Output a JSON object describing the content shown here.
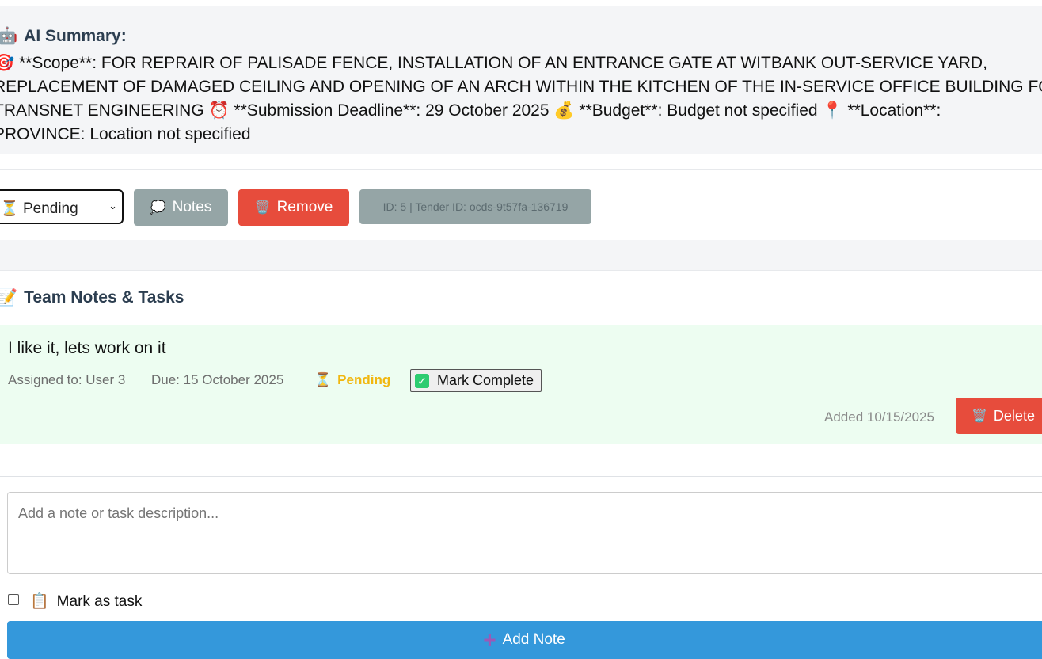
{
  "ai_summary": {
    "icon": "robot-icon",
    "title": "AI Summary:",
    "lines": [
      "🎯 **Scope**: FOR REPRAIR OF PALISADE FENCE, INSTALLATION OF AN ENTRANCE GATE AT WITBANK OUT-SERVICE YARD,",
      "REPLACEMENT OF DAMAGED CEILING AND OPENING OF AN ARCH WITHIN THE KITCHEN OF THE IN-SERVICE OFFICE BUILDING FOR",
      "TRANSNET ENGINEERING ⏰ **Submission Deadline**: 29 October 2025 💰 **Budget**: Budget not specified 📍 **Location**:",
      "PROVINCE: Location not specified"
    ]
  },
  "actions": {
    "status_select": {
      "icon": "hourglass-icon",
      "value": "Pending",
      "options": [
        "Pending"
      ]
    },
    "notes_label": "Notes",
    "remove_label": "Remove",
    "id_label": "ID: 5 | Tender ID: ocds-9t57fa-136719"
  },
  "notes_section": {
    "icon": "memo-icon",
    "title": "Team Notes & Tasks",
    "items": [
      {
        "text": "I like it, lets work on it",
        "assigned": "Assigned to: User 3",
        "due": "Due: 15 October 2025",
        "status": "Pending",
        "status_color": "#f1b70f",
        "mark_complete_label": "Mark Complete",
        "added": "Added 10/15/2025",
        "delete_label": "Delete"
      }
    ]
  },
  "add_note": {
    "placeholder": "Add a note or task description...",
    "mark_task_label": "Mark as task",
    "mark_task_icon": "clipboard-icon",
    "add_button_label": "Add Note"
  },
  "colors": {
    "danger": "#e74c3c",
    "secondary": "#95a5a6",
    "primary": "#3498db",
    "success_bg": "#edfdf1"
  }
}
